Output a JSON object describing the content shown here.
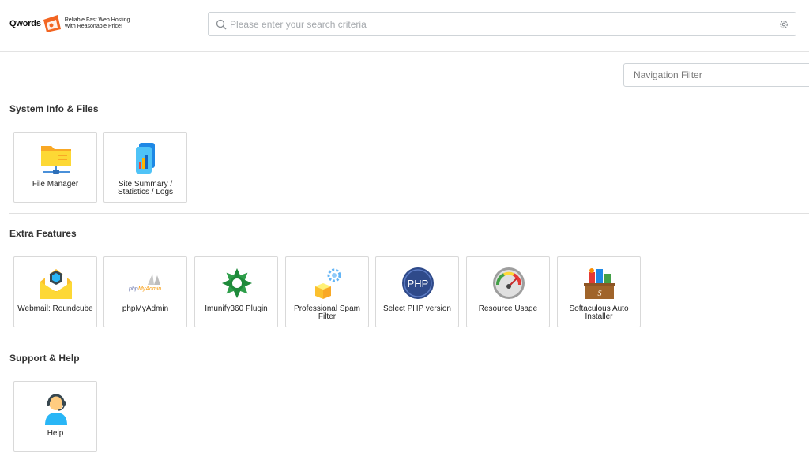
{
  "header": {
    "logo_word": "Qwords",
    "logo_tag_line1": "Reliable Fast Web Hosting",
    "logo_tag_line2": "With Reasonable Price!",
    "search_placeholder": "Please enter your search criteria"
  },
  "nav_filter": {
    "placeholder": "Navigation Filter"
  },
  "sections": [
    {
      "title": "System Info & Files",
      "items": [
        {
          "label": "File Manager",
          "icon": "folder-icon"
        },
        {
          "label": "Site Summary / Statistics / Logs",
          "icon": "statistics-icon"
        }
      ]
    },
    {
      "title": "Extra Features",
      "items": [
        {
          "label": "Webmail: Roundcube",
          "icon": "webmail-icon"
        },
        {
          "label": "phpMyAdmin",
          "icon": "phpmyadmin-icon"
        },
        {
          "label": "Imunify360 Plugin",
          "icon": "imunify360-icon"
        },
        {
          "label": "Professional Spam Filter",
          "icon": "spam-filter-icon"
        },
        {
          "label": "Select PHP version",
          "icon": "php-icon"
        },
        {
          "label": "Resource Usage",
          "icon": "gauge-icon"
        },
        {
          "label": "Softaculous Auto Installer",
          "icon": "softaculous-icon"
        }
      ]
    },
    {
      "title": "Support & Help",
      "items": [
        {
          "label": "Help",
          "icon": "support-agent-icon"
        }
      ]
    }
  ],
  "colors": {
    "accent_orange": "#f26522",
    "folder_yellow": "#fbc02d",
    "php_blue": "#2f4a8a",
    "imunify_green": "#1e8a3a",
    "border": "#d9d9d9"
  }
}
